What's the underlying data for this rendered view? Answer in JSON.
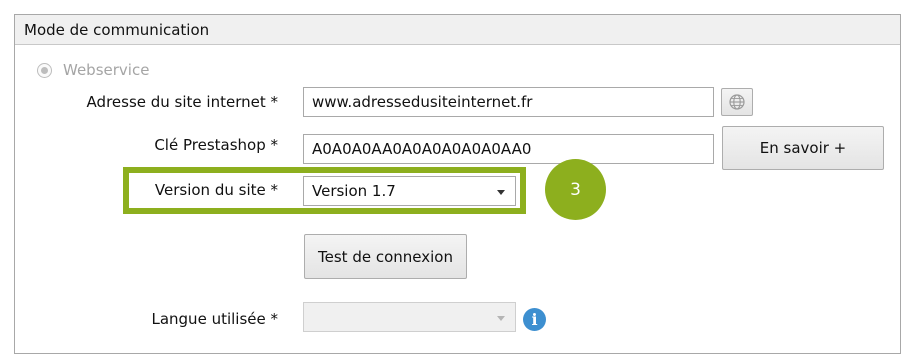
{
  "group": {
    "title": "Mode de communication"
  },
  "webservice_option": {
    "label": "Webservice",
    "selected": true,
    "enabled": false
  },
  "site_url": {
    "label": "Adresse du site internet *",
    "value": "www.adressedusiteinternet.fr"
  },
  "prestashop_key": {
    "label": "Clé Prestashop *",
    "value": "A0A0A0AA0A0A0A0A0A0AA0",
    "more_button": "En savoir +"
  },
  "site_version": {
    "label": "Version du site *",
    "value": "Version 1.7"
  },
  "test_button": {
    "label": "Test de connexion"
  },
  "language": {
    "label": "Langue utilisée *",
    "value": ""
  },
  "callout": {
    "number": "3",
    "color": "#8daf1e"
  },
  "icons": {
    "globe": "globe-icon",
    "info": "info-icon"
  }
}
